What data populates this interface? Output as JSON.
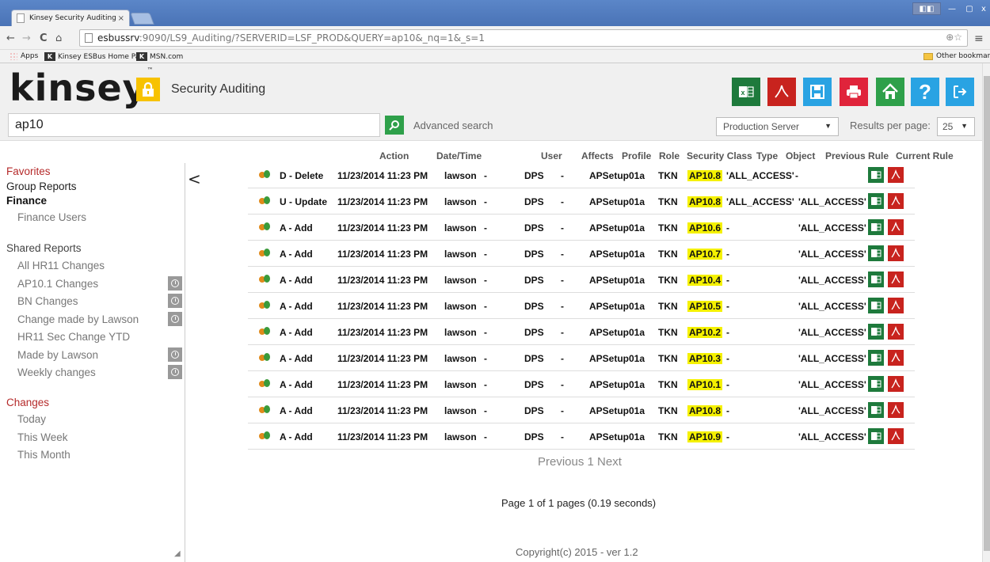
{
  "browser": {
    "tab_title": "Kinsey Security Auditing",
    "tab_close": "×",
    "profile_badge": "◧◧",
    "min_label": "—",
    "max_label": "▢",
    "close_label": "x",
    "back": "←",
    "forward": "→",
    "reload": "C",
    "home": "⌂",
    "url_host": "esbussrv",
    "url_rest": ":9090/LS9_Auditing/?SERVERID=LSF_PROD&QUERY=ap10&_nq=1&_s=1",
    "url_right": "⊕☆",
    "menu": "≡",
    "bookmarks": {
      "apps": "Apps",
      "esbus": "Kinsey ESBus Home Pa...",
      "msn": "MSN.com",
      "other": "Other bookmarks"
    }
  },
  "app": {
    "logo": "kinsey",
    "logo_tm": "™",
    "title": "Security Auditing",
    "header_buttons": [
      {
        "name": "excel",
        "color": "#1e7a3c",
        "glyph": "X"
      },
      {
        "name": "pdf",
        "color": "#c8231e",
        "glyph": "⅄"
      },
      {
        "name": "save",
        "color": "#29a3e3",
        "glyph": "H"
      },
      {
        "name": "print",
        "color": "#e0243b",
        "glyph": "🖶"
      },
      {
        "name": "home",
        "color": "#2ea04a",
        "glyph": "⌂"
      },
      {
        "name": "help",
        "color": "#29a3e3",
        "glyph": "?"
      },
      {
        "name": "logout",
        "color": "#29a3e3",
        "glyph": "↦"
      }
    ]
  },
  "search": {
    "value": "ap10",
    "advanced_label": "Advanced search",
    "server_value": "Production Server",
    "results_label": "Results per page:",
    "results_value": "25"
  },
  "sidebar": {
    "collapse": "<",
    "favorites": "Favorites",
    "group_reports": "Group Reports",
    "finance": "Finance",
    "finance_users": "Finance Users",
    "shared_reports": "Shared Reports",
    "shared_items": [
      {
        "label": "All HR11 Changes",
        "scheduled": false
      },
      {
        "label": "AP10.1 Changes",
        "scheduled": true
      },
      {
        "label": "BN Changes",
        "scheduled": true
      },
      {
        "label": "Change made by Lawson",
        "scheduled": true
      },
      {
        "label": "HR11 Sec Change YTD",
        "scheduled": false
      },
      {
        "label": "Made by Lawson",
        "scheduled": true
      },
      {
        "label": "Weekly changes",
        "scheduled": true
      }
    ],
    "changes": "Changes",
    "today": "Today",
    "this_week": "This Week",
    "this_month": "This Month"
  },
  "table": {
    "headers": [
      "Action",
      "Date/Time",
      "User",
      "Affects",
      "Profile",
      "Role",
      "Security Class",
      "Type",
      "Object",
      "Previous Rule",
      "Current Rule"
    ],
    "rows": [
      {
        "action": "D - Delete",
        "datetime": "11/23/2014 11:23 PM",
        "user": "lawson",
        "affects": "-",
        "profile": "DPS",
        "role": "-",
        "seccls": "APSetup01a",
        "type": "TKN",
        "object": "AP10.8",
        "prev": "'ALL_ACCESS'",
        "curr": "-"
      },
      {
        "action": "U - Update",
        "datetime": "11/23/2014 11:23 PM",
        "user": "lawson",
        "affects": "-",
        "profile": "DPS",
        "role": "-",
        "seccls": "APSetup01a",
        "type": "TKN",
        "object": "AP10.8",
        "prev": "'ALL_ACCESS'",
        "curr": "'ALL_ACCESS'"
      },
      {
        "action": "A - Add",
        "datetime": "11/23/2014 11:23 PM",
        "user": "lawson",
        "affects": "-",
        "profile": "DPS",
        "role": "-",
        "seccls": "APSetup01a",
        "type": "TKN",
        "object": "AP10.6",
        "prev": "-",
        "curr": "'ALL_ACCESS'"
      },
      {
        "action": "A - Add",
        "datetime": "11/23/2014 11:23 PM",
        "user": "lawson",
        "affects": "-",
        "profile": "DPS",
        "role": "-",
        "seccls": "APSetup01a",
        "type": "TKN",
        "object": "AP10.7",
        "prev": "-",
        "curr": "'ALL_ACCESS'"
      },
      {
        "action": "A - Add",
        "datetime": "11/23/2014 11:23 PM",
        "user": "lawson",
        "affects": "-",
        "profile": "DPS",
        "role": "-",
        "seccls": "APSetup01a",
        "type": "TKN",
        "object": "AP10.4",
        "prev": "-",
        "curr": "'ALL_ACCESS'"
      },
      {
        "action": "A - Add",
        "datetime": "11/23/2014 11:23 PM",
        "user": "lawson",
        "affects": "-",
        "profile": "DPS",
        "role": "-",
        "seccls": "APSetup01a",
        "type": "TKN",
        "object": "AP10.5",
        "prev": "-",
        "curr": "'ALL_ACCESS'"
      },
      {
        "action": "A - Add",
        "datetime": "11/23/2014 11:23 PM",
        "user": "lawson",
        "affects": "-",
        "profile": "DPS",
        "role": "-",
        "seccls": "APSetup01a",
        "type": "TKN",
        "object": "AP10.2",
        "prev": "-",
        "curr": "'ALL_ACCESS'"
      },
      {
        "action": "A - Add",
        "datetime": "11/23/2014 11:23 PM",
        "user": "lawson",
        "affects": "-",
        "profile": "DPS",
        "role": "-",
        "seccls": "APSetup01a",
        "type": "TKN",
        "object": "AP10.3",
        "prev": "-",
        "curr": "'ALL_ACCESS'"
      },
      {
        "action": "A - Add",
        "datetime": "11/23/2014 11:23 PM",
        "user": "lawson",
        "affects": "-",
        "profile": "DPS",
        "role": "-",
        "seccls": "APSetup01a",
        "type": "TKN",
        "object": "AP10.1",
        "prev": "-",
        "curr": "'ALL_ACCESS'"
      },
      {
        "action": "A - Add",
        "datetime": "11/23/2014 11:23 PM",
        "user": "lawson",
        "affects": "-",
        "profile": "DPS",
        "role": "-",
        "seccls": "APSetup01a",
        "type": "TKN",
        "object": "AP10.8",
        "prev": "-",
        "curr": "'ALL_ACCESS'"
      },
      {
        "action": "A - Add",
        "datetime": "11/23/2014 11:23 PM",
        "user": "lawson",
        "affects": "-",
        "profile": "DPS",
        "role": "-",
        "seccls": "APSetup01a",
        "type": "TKN",
        "object": "AP10.9",
        "prev": "-",
        "curr": "'ALL_ACCESS'"
      }
    ]
  },
  "footer": {
    "pager": "Previous 1 Next",
    "page_info": "Page 1 of 1 pages (0.19 seconds)",
    "copyright": "Copyright(c) 2015 - ver 1.2"
  }
}
